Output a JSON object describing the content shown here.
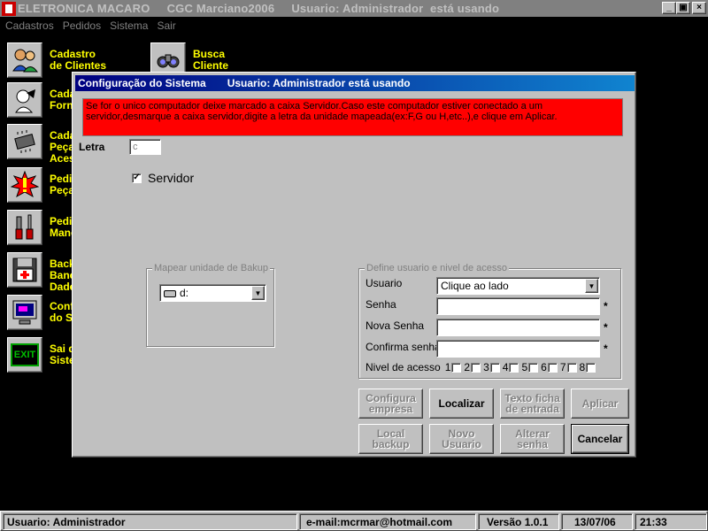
{
  "window": {
    "title": "ELETRONICA MACARO     CGC Marciano2006     Usuario: Administrador  está usando",
    "icon": "app-icon",
    "minimize": "_",
    "restore": "▣",
    "close": "×"
  },
  "menu": {
    "items": [
      "Cadastros",
      "Pedidos",
      "Sistema",
      "Sair"
    ]
  },
  "sidebar": {
    "items": [
      {
        "label": "Cadastro\nde Clientes",
        "icon": "people-icon"
      },
      {
        "label": "Cada\nForn",
        "icon": "handshake-icon"
      },
      {
        "label": "Cada\nPeça\nAces",
        "icon": "chip-icon"
      },
      {
        "label": "Pedi\nPeça",
        "icon": "alert-icon"
      },
      {
        "label": "Pedi\nMano",
        "icon": "tools-icon"
      },
      {
        "label": "Back\nBanc\nDade",
        "icon": "disk-icon"
      },
      {
        "label": "Conf\ndo S",
        "icon": "monitor-icon"
      },
      {
        "label": "Sai d\nSiste",
        "icon": "exit-icon"
      }
    ],
    "busca": {
      "label": "Busca\nCliente",
      "icon": "binoculars-icon"
    },
    "exit_text": "EXIT"
  },
  "dialog": {
    "title": "Configuração do Sistema",
    "title_user": "Usuario: Administrador  está usando",
    "alert": "Se for o unico computador deixe marcado a caixa Servidor.Caso este computador estiver conectado a um servidor,desmarque a caixa servidor,digite a letra da unidade mapeada(ex:F,G ou H,etc..),e clique em Aplicar.",
    "letra_label": "Letra",
    "letra_value": "c",
    "servidor_label": "Servidor",
    "servidor_checked": true,
    "backup_group": {
      "title": "Mapear unidade de Bakup",
      "drive_value": "d:"
    },
    "user_group": {
      "title": "Define usuario e nivel de acesso",
      "usuario_label": "Usuario",
      "usuario_value": "Clique ao lado",
      "senha_label": "Senha",
      "nova_senha_label": "Nova Senha",
      "confirma_label": "Confirma senha",
      "nivel_label": "Nivel de acesso",
      "levels": [
        "1",
        "2",
        "3",
        "4",
        "5",
        "6",
        "7",
        "8"
      ],
      "required_mark": "*"
    },
    "buttons": {
      "configura": "Configura\nempresa",
      "localizar": "Localizar",
      "texto_ficha": "Texto ficha\nde entrada",
      "aplicar": "Aplicar",
      "local_backup": "Local\nbackup",
      "novo_usuario": "Novo\nUsuario",
      "alterar_senha": "Alterar\nsenha",
      "cancelar": "Cancelar"
    }
  },
  "status": {
    "user": "Usuario: Administrador",
    "email": "e-mail:mcrmar@hotmail.com",
    "version": "Versão 1.0.1",
    "date": "13/07/06",
    "time": "21:33"
  }
}
